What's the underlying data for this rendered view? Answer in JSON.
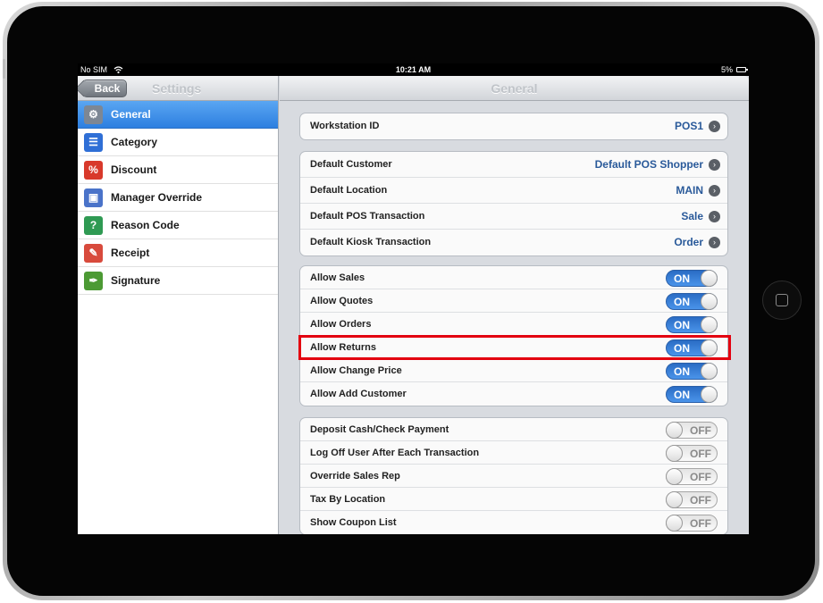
{
  "status_bar": {
    "carrier": "No SIM",
    "wifi_icon": "wifi-icon",
    "time": "10:21 AM",
    "battery": "5%"
  },
  "master": {
    "back_label": "Back",
    "title": "Settings",
    "selected_index": 0,
    "items": [
      {
        "label": "General",
        "icon": "gear-icon",
        "color": "#7d8794"
      },
      {
        "label": "Category",
        "icon": "list-icon",
        "color": "#2f6fd6"
      },
      {
        "label": "Discount",
        "icon": "discount-tag-icon",
        "color": "#d8392b"
      },
      {
        "label": "Manager Override",
        "icon": "manager-icon",
        "color": "#4a73c9"
      },
      {
        "label": "Reason Code",
        "icon": "reason-code-icon",
        "color": "#2f9a53"
      },
      {
        "label": "Receipt",
        "icon": "receipt-icon",
        "color": "#d84a3c"
      },
      {
        "label": "Signature",
        "icon": "signature-icon",
        "color": "#4c9a34"
      }
    ]
  },
  "detail": {
    "title": "General",
    "workstation": {
      "label": "Workstation ID",
      "value": "POS1"
    },
    "defaults": [
      {
        "label": "Default Customer",
        "value": "Default POS Shopper"
      },
      {
        "label": "Default Location",
        "value": "MAIN"
      },
      {
        "label": "Default POS Transaction",
        "value": "Sale"
      },
      {
        "label": "Default Kiosk Transaction",
        "value": "Order"
      }
    ],
    "allow_toggles": [
      {
        "label": "Allow Sales",
        "state": "ON"
      },
      {
        "label": "Allow Quotes",
        "state": "ON"
      },
      {
        "label": "Allow Orders",
        "state": "ON"
      },
      {
        "label": "Allow Returns",
        "state": "ON"
      },
      {
        "label": "Allow Change Price",
        "state": "ON"
      },
      {
        "label": "Allow Add Customer",
        "state": "ON"
      }
    ],
    "other_toggles": [
      {
        "label": "Deposit Cash/Check Payment",
        "state": "OFF"
      },
      {
        "label": "Log Off User After Each Transaction",
        "state": "OFF"
      },
      {
        "label": "Override Sales Rep",
        "state": "OFF"
      },
      {
        "label": "Tax By Location",
        "state": "OFF"
      },
      {
        "label": "Show Coupon List",
        "state": "OFF"
      }
    ]
  },
  "highlight": {
    "color": "#e3000f",
    "target": "Allow Returns"
  },
  "colors": {
    "selected_row": "#2d7fe0",
    "toggle_on": "#2a6cc4",
    "value_text": "#2a5a9a"
  }
}
